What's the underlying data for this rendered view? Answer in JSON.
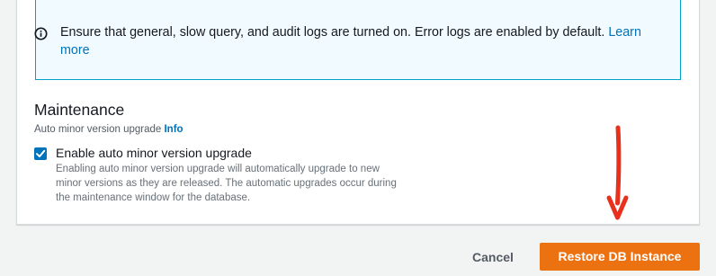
{
  "info_alert": {
    "icon": "info-circle-icon",
    "text": "Ensure that general, slow query, and audit logs are turned on. Error logs are enabled by default.",
    "link_label": "Learn more",
    "accent_color": "#00a1c9"
  },
  "maintenance": {
    "heading": "Maintenance",
    "subheading": "Auto minor version upgrade",
    "info_link": "Info",
    "checkbox": {
      "label": "Enable auto minor version upgrade",
      "checked": true,
      "description": "Enabling auto minor version upgrade will automatically upgrade to new minor versions as they are released. The automatic upgrades occur during the maintenance window for the database."
    }
  },
  "footer": {
    "cancel_label": "Cancel",
    "primary_label": "Restore DB Instance",
    "primary_color": "#ec7211"
  },
  "annotation": {
    "arrow_color": "#e8301c"
  }
}
